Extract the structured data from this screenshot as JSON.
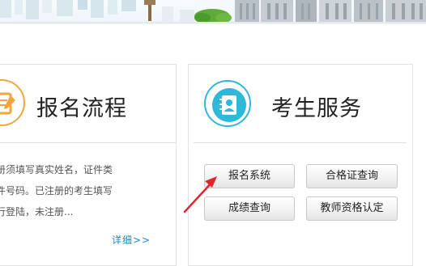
{
  "left_card": {
    "title": "报名流程",
    "desc_lines": [
      "未注册须填写真实姓名，证件类",
      "及证件号码。已注册的考生填写",
      "号进行登陆，未注册..."
    ],
    "more_link": "详细>>",
    "icon": "edit-form-icon"
  },
  "right_card": {
    "title": "考生服务",
    "icon": "contact-book-icon",
    "buttons": {
      "registration": "报名系统",
      "certificate_query": "合格证查询",
      "score_query": "成绩查询",
      "teacher_qualification": "教师资格认定"
    }
  },
  "colors": {
    "accent_orange": "#f3a53c",
    "accent_teal": "#2fb8d8",
    "link_blue": "#1f86c9",
    "arrow_red": "#e0262b"
  }
}
